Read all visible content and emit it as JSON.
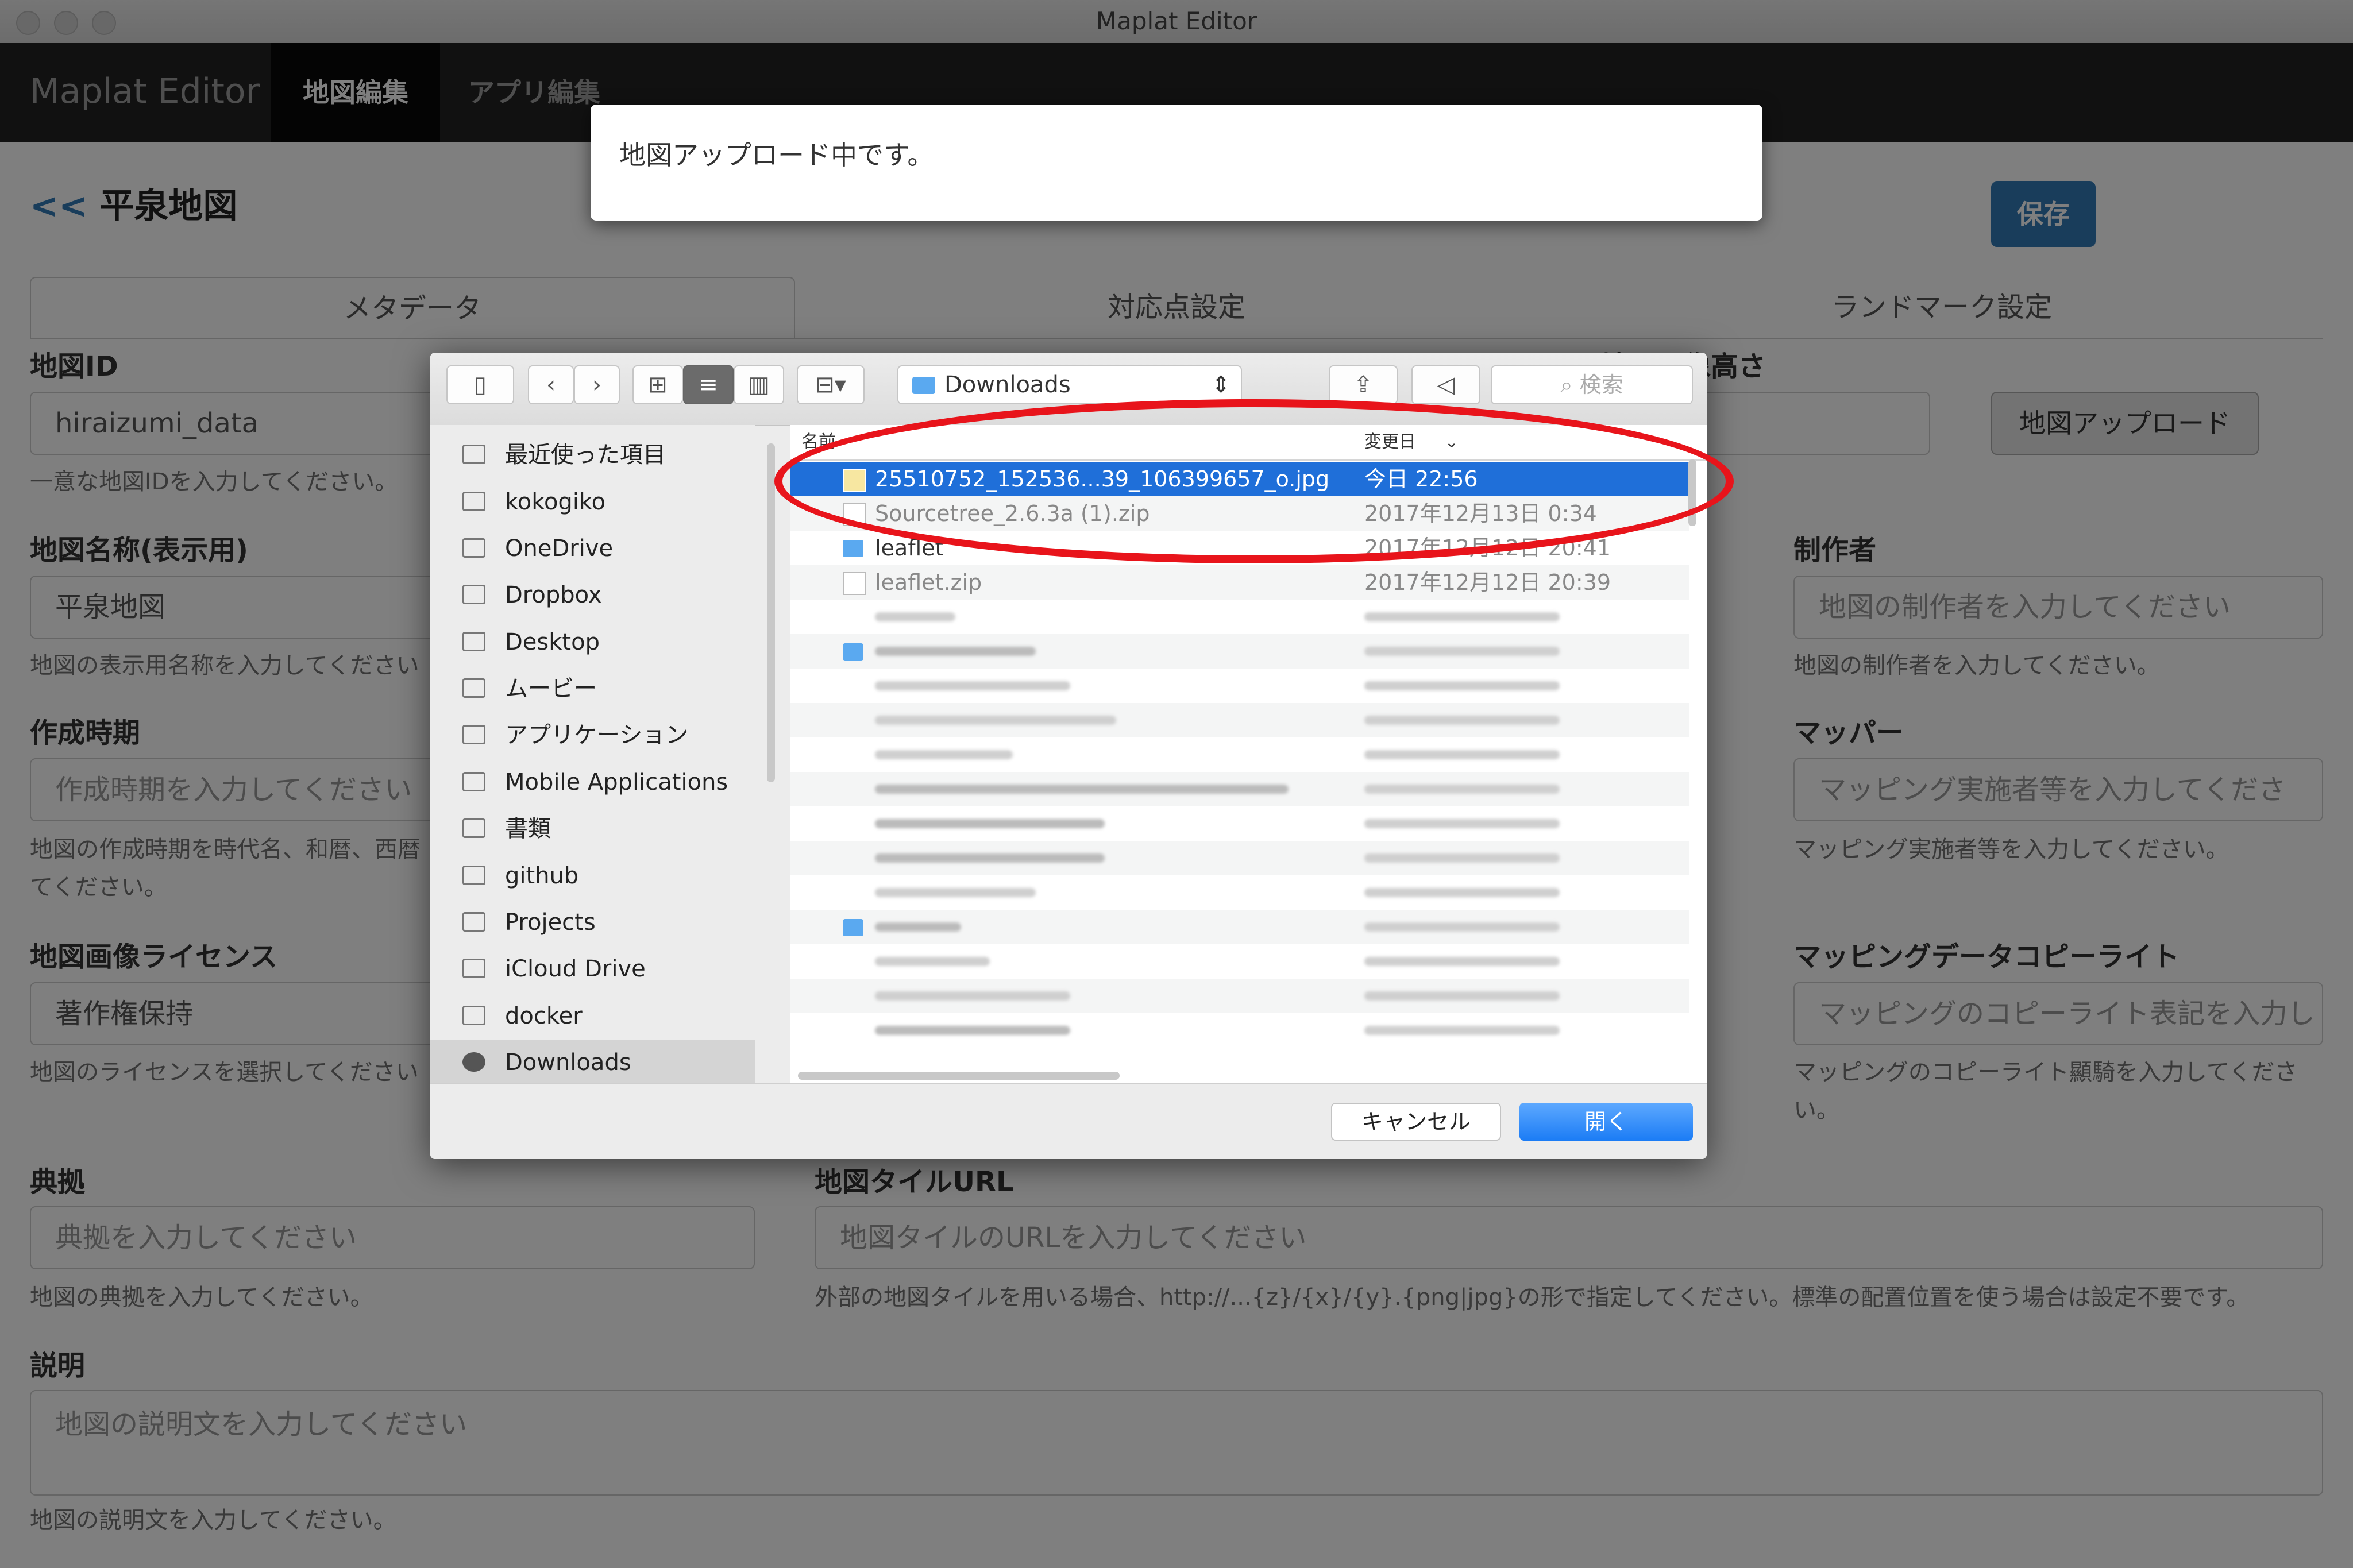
{
  "window": {
    "title": "Maplat Editor"
  },
  "navbar": {
    "brand": "Maplat Editor",
    "tabs": [
      {
        "label": "地図編集",
        "active": true
      },
      {
        "label": "アプリ編集",
        "active": false
      }
    ]
  },
  "editor": {
    "back_arrow": "<<",
    "map_title": "平泉地図",
    "save_label": "保存",
    "tabs": [
      {
        "label": "メタデータ"
      },
      {
        "label": "対応点設定"
      },
      {
        "label": "ランドマーク設定"
      }
    ],
    "fields": {
      "map_id": {
        "label": "地図ID",
        "value": "hiraizumi_data",
        "help": "一意な地図IDを入力してください。"
      },
      "map_name": {
        "label": "地図名称(表示用)",
        "value": "平泉地図",
        "help": "地図の表示用名称を入力してください"
      },
      "created_era": {
        "label": "作成時期",
        "placeholder": "作成時期を入力してください",
        "help_line1": "地図の作成時期を時代名、和暦、西暦",
        "help_line2": "てください。"
      },
      "license": {
        "label": "地図画像ライセンス",
        "value": "著作権保持",
        "help": "地図のライセンスを選択してください"
      },
      "image_height": {
        "label": "地図画像高さ"
      },
      "creator": {
        "label": "制作者",
        "placeholder": "地図の制作者を入力してください",
        "help": "地図の制作者を入力してください。"
      },
      "mapper": {
        "label": "マッパー",
        "placeholder": "マッピング実施者等を入力してくださ",
        "help": "マッピング実施者等を入力してください。"
      },
      "mapping_copyright": {
        "label": "マッピングデータコピーライト",
        "placeholder": "マッピングのコピーライト表記を入力し",
        "help_line1": "マッピングのコピーライト顯騎を入力してくださ",
        "help_line2": "い。"
      },
      "source": {
        "label": "典拠",
        "placeholder": "典拠を入力してください",
        "help": "地図の典拠を入力してください。"
      },
      "tile_url": {
        "label": "地図タイルURL",
        "placeholder": "地図タイルのURLを入力してください",
        "help": "外部の地図タイルを用いる場合、http://...{z}/{x}/{y}.{png|jpg}の形で指定してください。標準の配置位置を使う場合は設定不要です。"
      },
      "description": {
        "label": "説明",
        "placeholder": "地図の説明文を入力してください",
        "help": "地図の説明文を入力してください。"
      }
    },
    "upload_button": "地図アップロード"
  },
  "modal": {
    "message": "地図アップロード中です。"
  },
  "file_dialog": {
    "path_label": "Downloads",
    "search_placeholder": "検索",
    "sidebar": [
      {
        "label": "最近使った項目",
        "icon": "recents-icon"
      },
      {
        "label": "kokogiko",
        "icon": "home-icon"
      },
      {
        "label": "OneDrive",
        "icon": "folder-icon"
      },
      {
        "label": "Dropbox",
        "icon": "folder-icon"
      },
      {
        "label": "Desktop",
        "icon": "desktop-icon"
      },
      {
        "label": "ムービー",
        "icon": "movies-icon"
      },
      {
        "label": "アプリケーション",
        "icon": "applications-icon"
      },
      {
        "label": "Mobile Applications",
        "icon": "folder-icon"
      },
      {
        "label": "書類",
        "icon": "documents-icon"
      },
      {
        "label": "github",
        "icon": "folder-icon"
      },
      {
        "label": "Projects",
        "icon": "folder-icon"
      },
      {
        "label": "iCloud Drive",
        "icon": "cloud-icon"
      },
      {
        "label": "docker",
        "icon": "folder-icon"
      },
      {
        "label": "Downloads",
        "icon": "downloads-icon",
        "active": true
      }
    ],
    "columns": {
      "name": "名前",
      "date": "変更日"
    },
    "files": [
      {
        "name": "25510752_152536...39_106399657_o.jpg",
        "date": "今日 22:56",
        "selected": true
      },
      {
        "name": "Sourcetree_2.6.3a (1).zip",
        "date": "2017年12月13日 0:34",
        "dim": true
      },
      {
        "name": "leaflet",
        "date": "2017年12月12日 20:41",
        "folder": true
      },
      {
        "name": "leaflet.zip",
        "date": "2017年12月12日 20:39",
        "dim": true
      }
    ],
    "cancel_label": "キャンセル",
    "open_label": "開く"
  },
  "colors": {
    "primary": "#337ab7",
    "navbar": "#222222",
    "selection": "#1f6fd9",
    "annotation": "#e8141b"
  }
}
